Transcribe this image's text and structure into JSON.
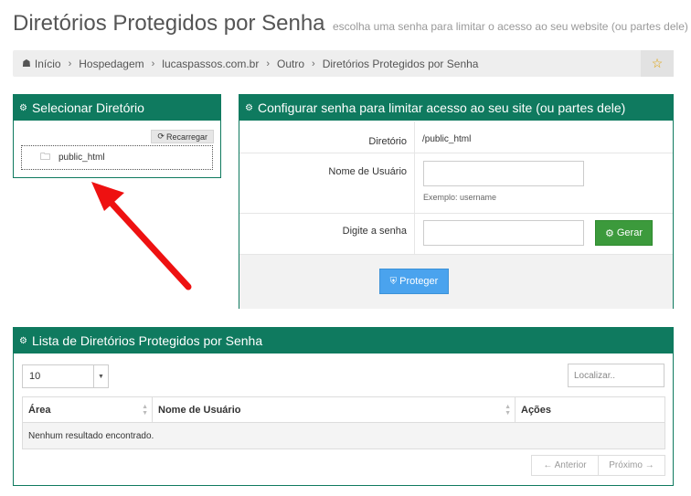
{
  "header": {
    "title": "Diretórios Protegidos por Senha",
    "subtitle": "escolha uma senha para limitar o acesso ao seu website (ou partes dele)"
  },
  "breadcrumb": {
    "items": [
      "Início",
      "Hospedagem",
      "lucaspassos.com.br",
      "Outro",
      "Diretórios Protegidos por Senha"
    ],
    "home_icon": "home-icon",
    "favorite_icon": "star-icon"
  },
  "select_panel": {
    "title": "Selecionar Diretório",
    "reload_label": "Recarregar",
    "directory": "public_html"
  },
  "config_panel": {
    "title": "Configurar senha para limitar acesso ao seu site (ou partes dele)",
    "directory_label": "Diretório",
    "directory_value": "/public_html",
    "username_label": "Nome de Usuário",
    "username_value": "",
    "username_hint": "Exemplo: username",
    "password_label": "Digite a senha",
    "password_value": "",
    "generate_label": "Gerar",
    "protect_label": "Proteger"
  },
  "list_panel": {
    "title": "Lista de Diretórios Protegidos por Senha",
    "page_length": "10",
    "search_placeholder": "Localizar..",
    "columns": [
      "Área",
      "Nome de Usuário",
      "Ações"
    ],
    "empty_message": "Nenhum resultado encontrado.",
    "prev_label": "← Anterior",
    "next_label": "Próximo →"
  },
  "colors": {
    "panel_header": "#0f7a5f",
    "generate_button": "#3c9a3c",
    "protect_button": "#4aa3ee",
    "annotation_arrow": "#ee1111"
  }
}
